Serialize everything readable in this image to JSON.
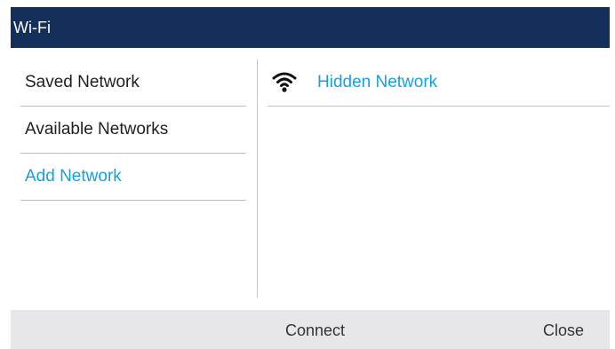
{
  "title": "Wi-Fi",
  "sidebar": {
    "items": [
      {
        "label": "Saved Network"
      },
      {
        "label": "Available Networks"
      },
      {
        "label": "Add Network"
      }
    ],
    "selected_index": 2
  },
  "networks": [
    {
      "name": "Hidden Network",
      "icon": "wifi-icon"
    }
  ],
  "softkeys": {
    "connect": "Connect",
    "close": "Close"
  },
  "colors": {
    "title_bar": "#14305a",
    "accent": "#18a0db",
    "softkey_bar": "#e7e7e9"
  }
}
